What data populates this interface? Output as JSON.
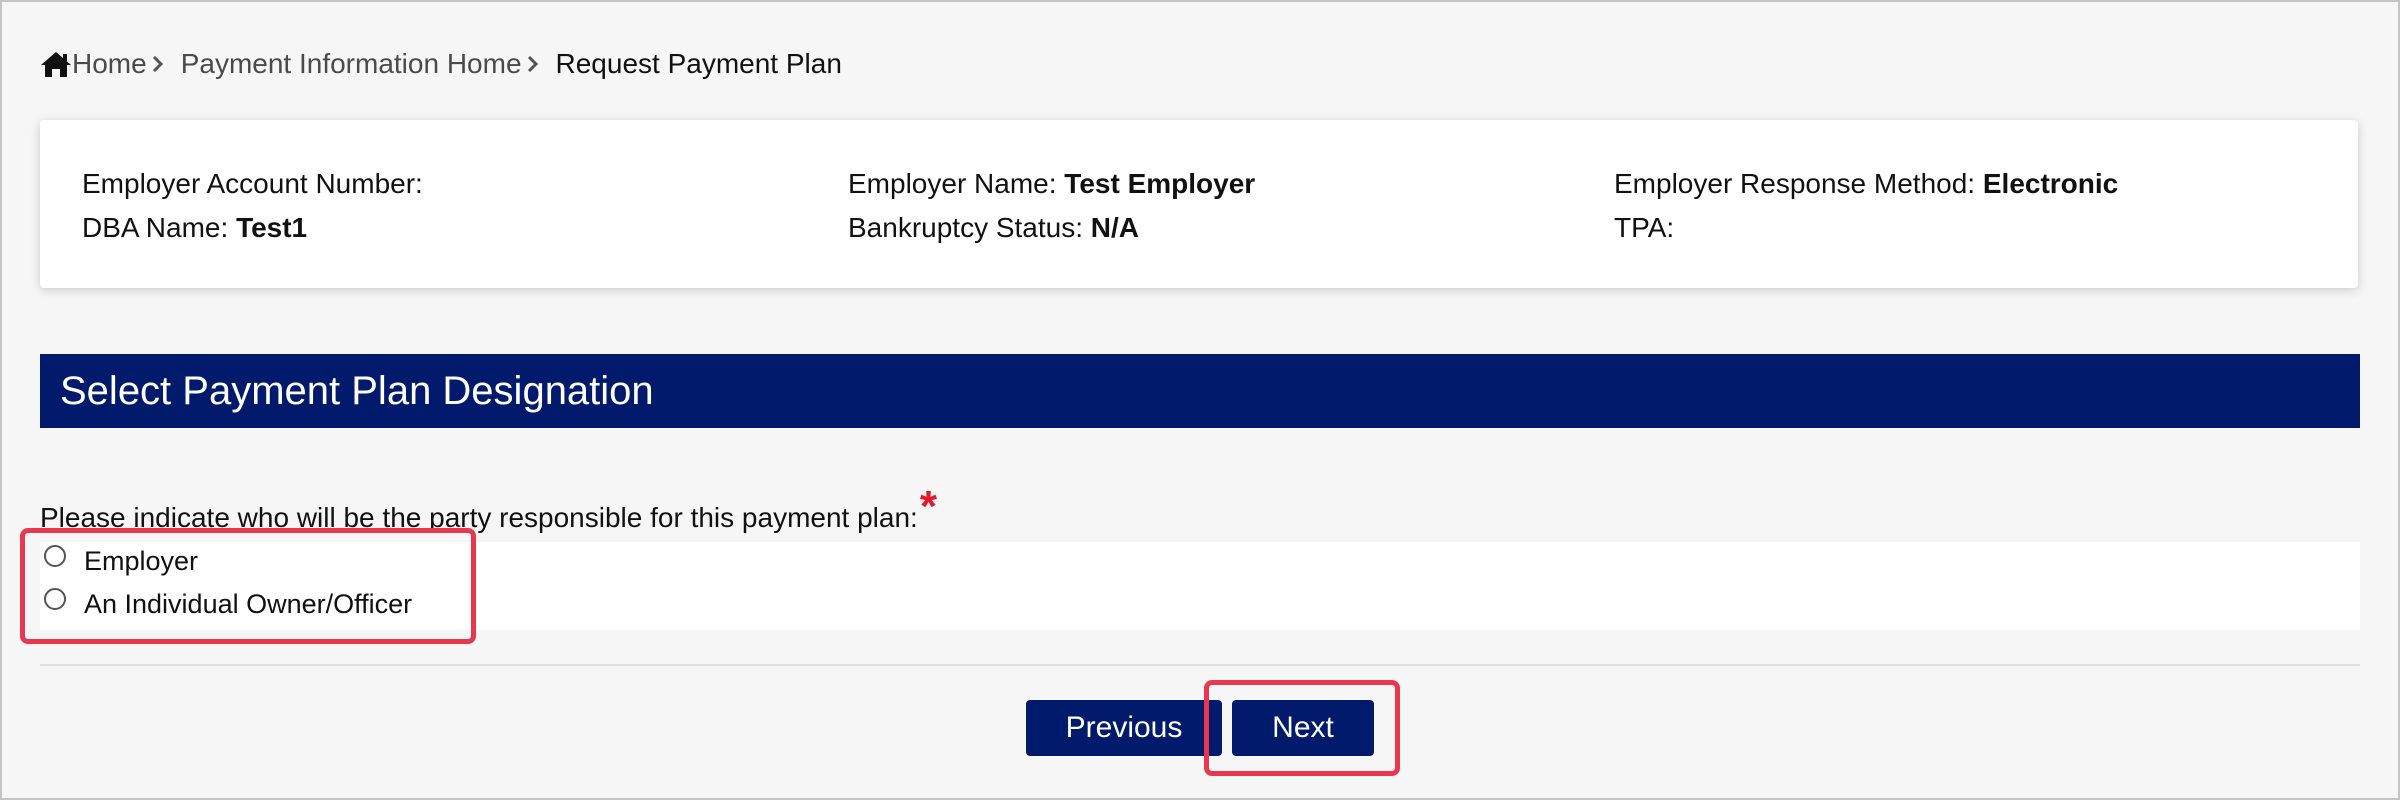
{
  "breadcrumb": {
    "home_icon": "home-icon",
    "items": [
      {
        "label": "Home"
      },
      {
        "label": "Payment Information Home"
      },
      {
        "label": "Request Payment Plan"
      }
    ],
    "separator_icon": "chevron-right-icon"
  },
  "employer_info": {
    "account_number_label": "Employer Account Number:",
    "account_number_value": "",
    "dba_name_label": "DBA Name:",
    "dba_name_value": "Test1",
    "employer_name_label": "Employer Name:",
    "employer_name_value": "Test Employer",
    "bankruptcy_status_label": "Bankruptcy Status:",
    "bankruptcy_status_value": "N/A",
    "response_method_label": "Employer Response Method:",
    "response_method_value": "Electronic",
    "tpa_label": "TPA:",
    "tpa_value": ""
  },
  "section": {
    "title": "Select Payment Plan Designation"
  },
  "question": {
    "label": "Please indicate who will be the party responsible for this payment plan:",
    "required_marker": "*"
  },
  "options": [
    {
      "label": "Employer",
      "selected": false
    },
    {
      "label": "An Individual Owner/Officer",
      "selected": false
    }
  ],
  "buttons": {
    "previous_label": "Previous",
    "next_label": "Next"
  },
  "colors": {
    "primary_navy": "#011a6b",
    "required_red": "#e8162b",
    "highlight_red": "#e8384f",
    "page_background": "#f6f6f6"
  }
}
